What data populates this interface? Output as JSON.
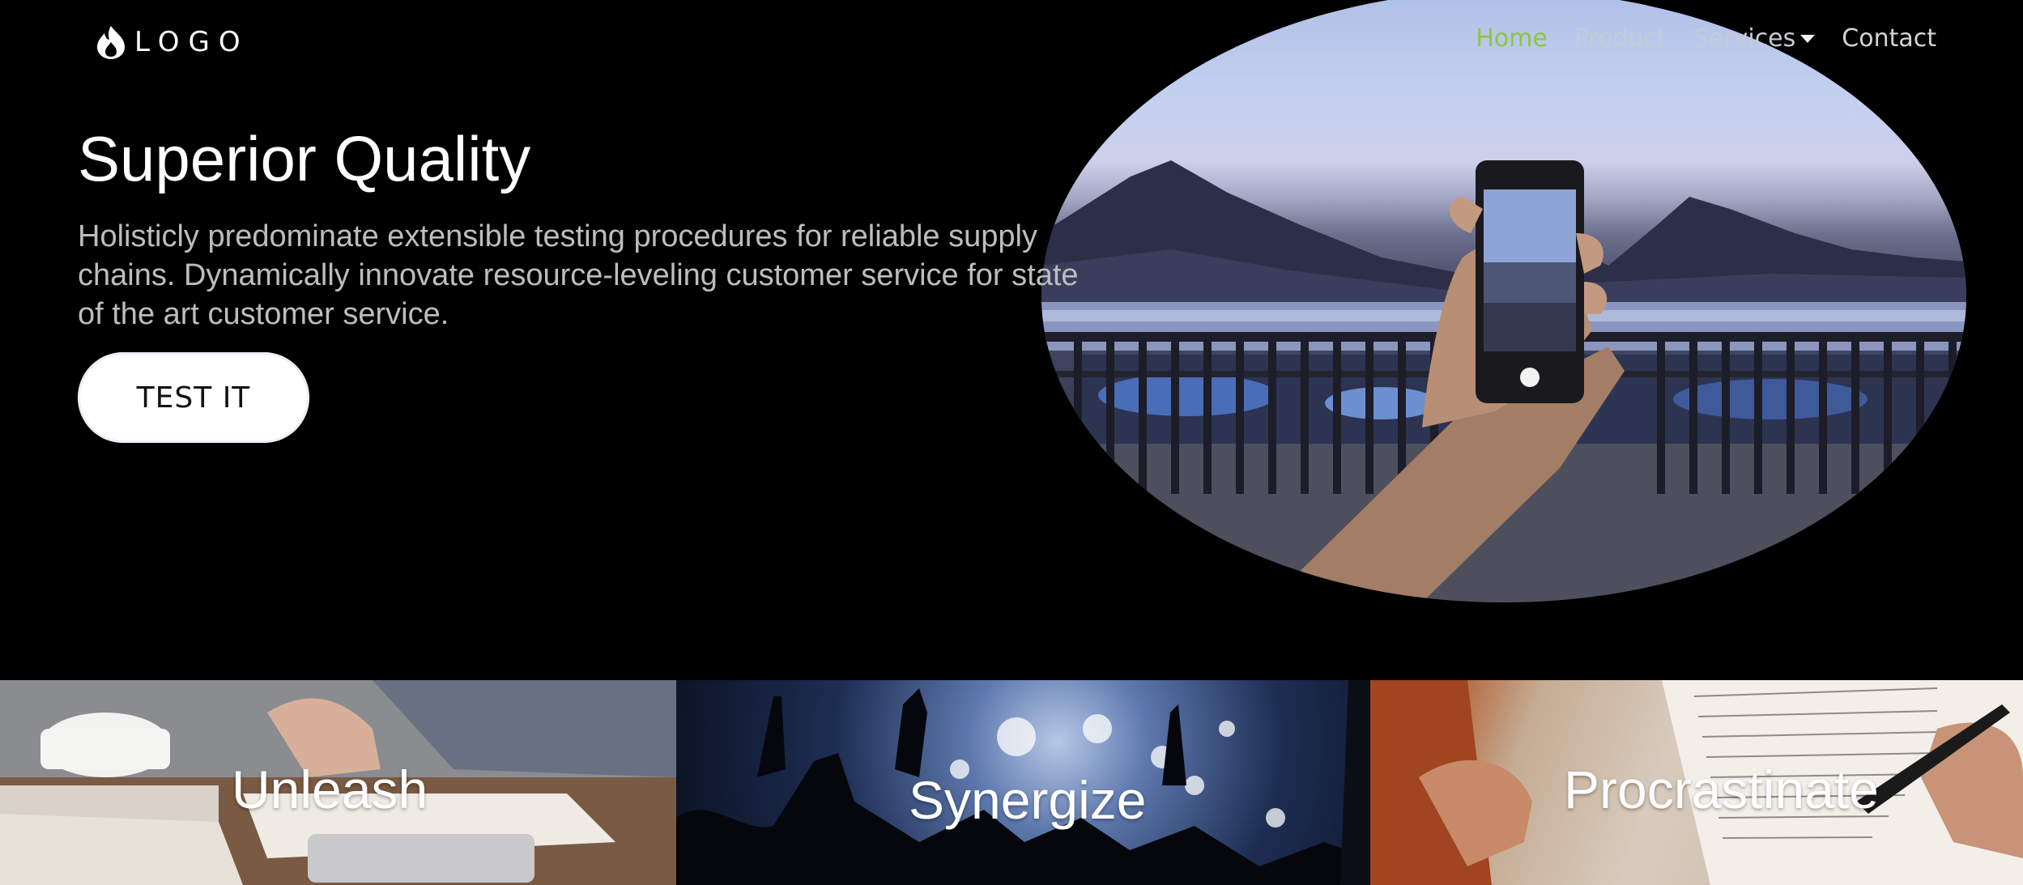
{
  "brand": {
    "logo_text": "LOGO",
    "logo_icon": "flame-icon"
  },
  "nav": {
    "items": [
      {
        "label": "Home",
        "active": true
      },
      {
        "label": "Product"
      },
      {
        "label": "Services",
        "has_dropdown": true
      },
      {
        "label": "Contact"
      }
    ]
  },
  "hero": {
    "title": "Superior Quality",
    "description": "Holisticly predominate extensible testing procedures for reliable supply chains. Dynamically innovate resource-leveling customer service for state of the art customer service.",
    "cta_label": "TEST IT"
  },
  "tiles": [
    {
      "label": "Unleash"
    },
    {
      "label": "Synergize"
    },
    {
      "label": "Procrastinate"
    }
  ],
  "colors": {
    "background": "#000000",
    "nav_active": "#8dc63f",
    "nav_inactive": "#c4ccd6",
    "title": "#ffffff",
    "description": "#bdbdbd",
    "button_bg": "#ffffff"
  }
}
